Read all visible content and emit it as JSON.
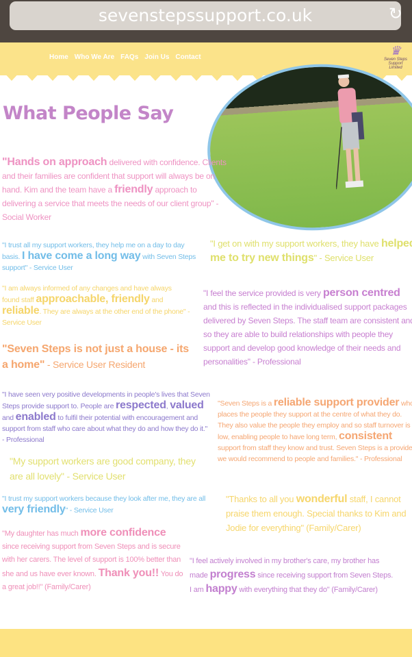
{
  "browser": {
    "url": "sevenstepssupport.co.uk",
    "reload_icon": "reload-icon"
  },
  "nav": [
    "Home",
    "Who We Are",
    "FAQs",
    "Join Us",
    "Contact"
  ],
  "logo": {
    "name": "Seven Steps Support",
    "sub": "Limited"
  },
  "title": "What People Say",
  "colors": {
    "header": "#fbe38a",
    "title": "#c385c8"
  },
  "quotes": [
    {
      "color": "#ee92c2",
      "size": 12,
      "seg": [
        [
          "\"Hands on approach",
          true
        ],
        [
          " delivered with confidence. Clients and their families are confident that support will always be on hand. Kim and the team have a ",
          false
        ],
        [
          "friendly",
          true
        ],
        [
          " approach to delivering a service that meets the needs of our client group\" - Social Worker",
          false
        ]
      ]
    },
    {
      "color": "#72bde8",
      "seg": [
        [
          "\"I trust all my support workers, they help me on a day to day basis. ",
          false
        ],
        [
          "I have come a long way",
          true
        ],
        [
          " with Seven Steps support\" - Service User",
          false
        ]
      ]
    },
    {
      "color": "#f5d56a",
      "seg": [
        [
          "\"I am always informed of any changes and have always found staff ",
          false
        ],
        [
          "approachable, friendly",
          true
        ],
        [
          " and ",
          false
        ],
        [
          "reliable",
          true
        ],
        [
          ". They are always at the other end of the phone\" - Service User",
          false
        ]
      ]
    },
    {
      "color": "#f5a66e",
      "size": 14,
      "seg": [
        [
          "\"Seven Steps is not just a house - its a home\"",
          true
        ],
        [
          " - Service User Resident",
          false
        ]
      ]
    },
    {
      "color": "#dfe06c",
      "size": 13,
      "seg": [
        [
          "\"I get on with my support workers, they have ",
          false
        ],
        [
          "helped me to try new things",
          true
        ],
        [
          "\" - Service User",
          false
        ]
      ]
    },
    {
      "color": "#c77fd0",
      "size": 12,
      "seg": [
        [
          "\"I feel the service provided is very ",
          false
        ],
        [
          "person centred",
          true
        ],
        [
          " and this is reflected in the individualised support packages delivered by Seven Steps. The staff team are consistent and so they are able to build relationships with people they support and develop good knowledge of their needs and personalities\" - Professional",
          false
        ]
      ]
    },
    {
      "color": "#8c79cc",
      "seg": [
        [
          "\"I have seen very positive developments in people's lives that Seven Steps provide support to. People are ",
          false
        ],
        [
          "respected",
          true
        ],
        [
          ", ",
          false
        ],
        [
          "valued",
          true
        ],
        [
          " and ",
          false
        ],
        [
          "enabled",
          true
        ],
        [
          " to fulfil their potential with encouragement and support from staff who care about what they do and how they do it.\" - Professional",
          false
        ]
      ]
    },
    {
      "color": "#f5a672",
      "seg": [
        [
          "\"Seven Steps is a ",
          false
        ],
        [
          "reliable support provider",
          true
        ],
        [
          " who places the people they support at the centre of what they do. They also value the people they employ and so staff turnover is low, enabling people to have long term, ",
          false
        ],
        [
          "consistent",
          true
        ],
        [
          " support from staff they know and trust. Seven Steps is a provider we would recommend to people and families.\" - Professional",
          false
        ]
      ]
    },
    {
      "color": "#e2e070",
      "size": 14,
      "seg": [
        [
          "\"My support workers are good company, they are all lovely\" - Service User",
          false
        ]
      ]
    },
    {
      "color": "#72bde8",
      "seg": [
        [
          "\"I trust my support workers because they look after me, they are all ",
          false
        ],
        [
          "very friendly",
          true
        ],
        [
          "\" - Service User",
          false
        ]
      ]
    },
    {
      "color": "#f6d66c",
      "size": 13,
      "seg": [
        [
          "\"Thanks to all you ",
          false
        ],
        [
          "wonderful",
          true
        ],
        [
          " staff, I cannot praise them enough. Special thanks to Kim and Jodie for everything\" (Family/Carer)",
          false
        ]
      ]
    },
    {
      "color": "#ef8fb8",
      "size": 11,
      "seg": [
        [
          "\"My daughter has much ",
          false
        ],
        [
          "more confidence",
          true
        ],
        [
          " since receiving support from Seven Steps and is secure with her carers. The level of support is 100% better than she and us have ever known. ",
          false
        ],
        [
          "Thank you!!",
          true
        ],
        [
          " You do a great job!!\" (Family/Carer)",
          false
        ]
      ]
    },
    {
      "color": "#c27fcf",
      "size": 11,
      "seg": [
        [
          "\"I feel actively involved in my brother's care, my brother has made ",
          false
        ],
        [
          "progress",
          true
        ],
        [
          " since receiving support from Seven Steps. I am ",
          false
        ],
        [
          "happy",
          true
        ],
        [
          " with everything that they do\" (Family/Carer)",
          false
        ]
      ]
    }
  ]
}
